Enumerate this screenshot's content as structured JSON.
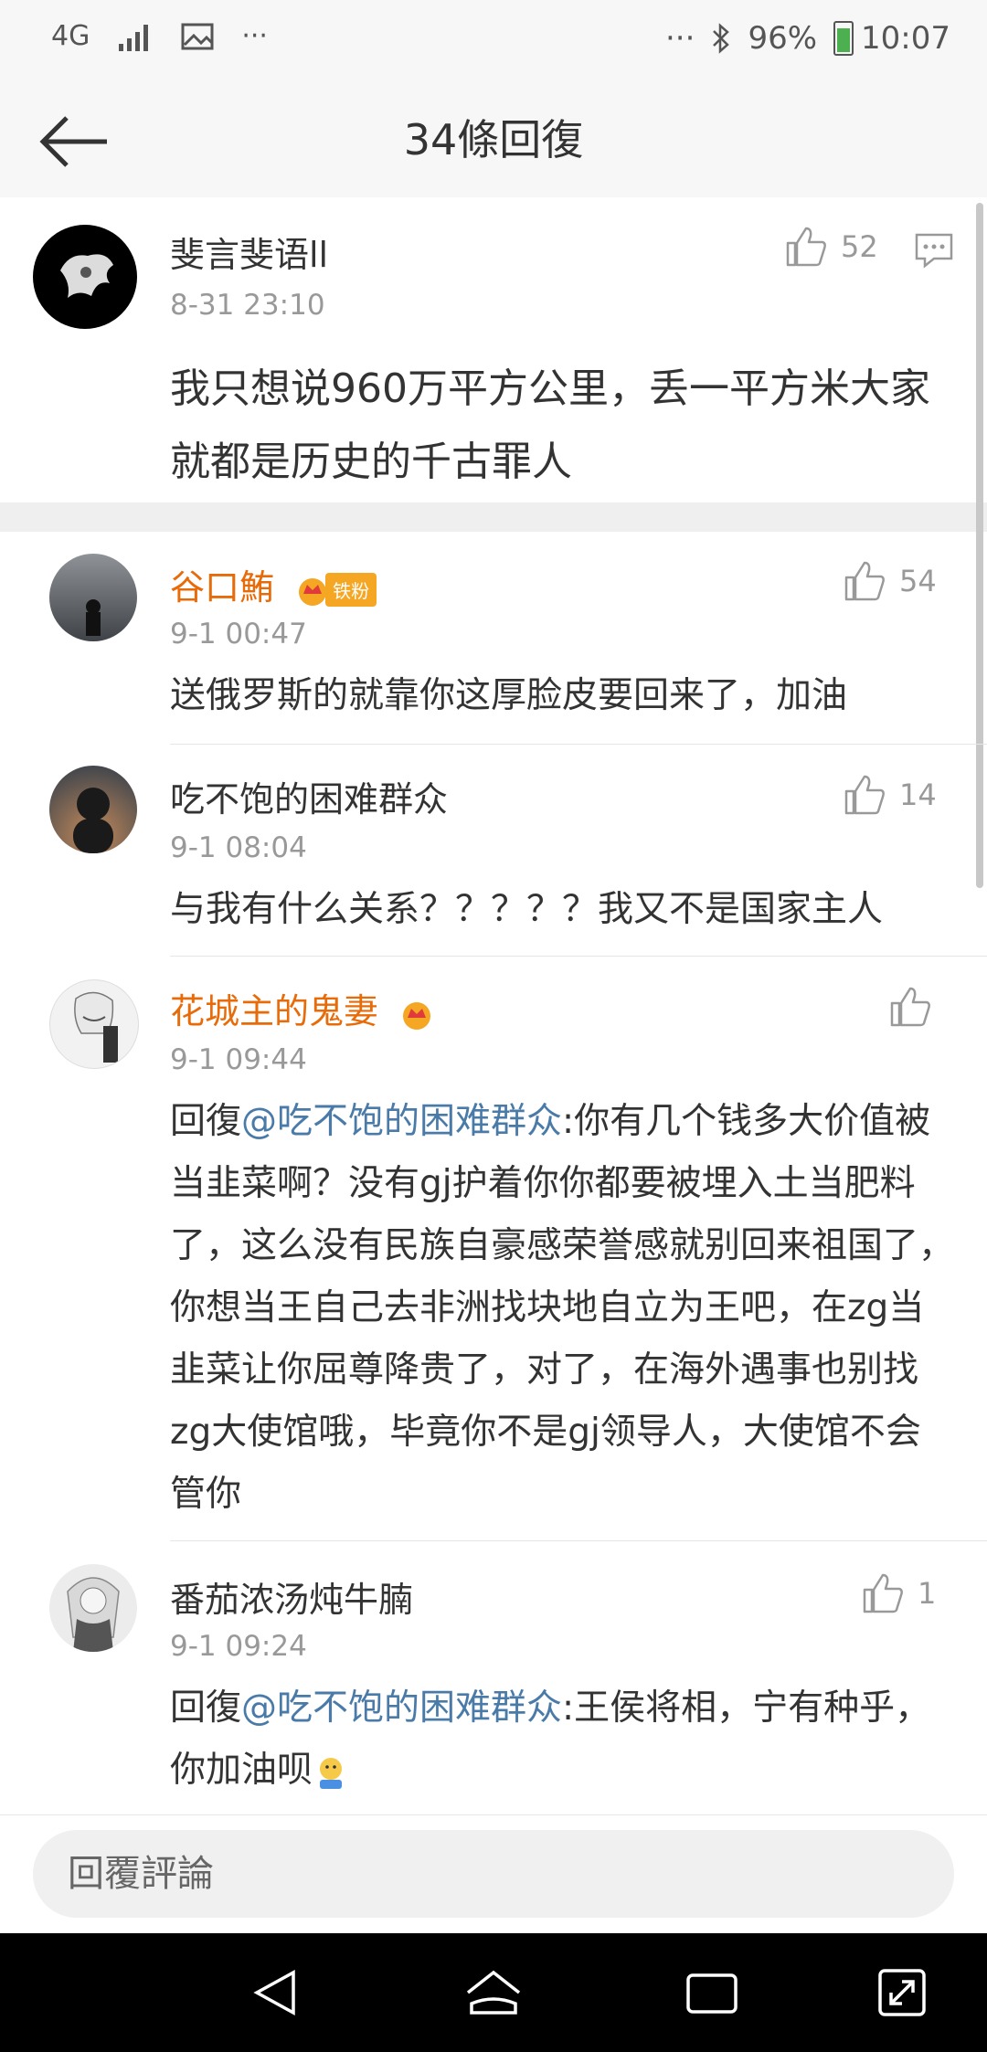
{
  "status_bar": {
    "network": "4G",
    "dots_left": "···",
    "dots_right": "···",
    "battery": "96%",
    "time": "10:07"
  },
  "header": {
    "title": "34條回復"
  },
  "main_comment": {
    "username": "斐言斐语ll",
    "time": "8-31 23:10",
    "likes": "52",
    "content": "我只想说960万平方公里，丢一平方米大家就都是历史的千古罪人"
  },
  "replies": [
    {
      "username": "谷口鮪",
      "badge": "铁粉",
      "time": "9-1 00:47",
      "likes": "54",
      "content": "送俄罗斯的就靠你这厚脸皮要回来了，加油"
    },
    {
      "username": "吃不饱的困难群众",
      "time": "9-1 08:04",
      "likes": "14",
      "content": "与我有什么关系？？？？？我又不是国家主人"
    },
    {
      "username": "花城主的鬼妻",
      "time": "9-1 09:44",
      "likes": "",
      "prefix": "回復",
      "mention": "@吃不饱的困难群众",
      "content": ":你有几个钱多大价值被当韭菜啊？没有gj护着你你都要被埋入土当肥料了，这么没有民族自豪感荣誉感就别回来祖国了，你想当王自己去非洲找块地自立为王吧，在zg当韭菜让你屈尊降贵了，对了，在海外遇事也别找zg大使馆哦，毕竟你不是gj领导人，大使馆不会管你"
    },
    {
      "username": "番茄浓汤炖牛腩",
      "time": "9-1 09:24",
      "likes": "1",
      "prefix": "回復",
      "mention": "@吃不饱的困难群众",
      "content": ":王侯将相，宁有种乎，你加油呗"
    }
  ],
  "input": {
    "placeholder": "回覆評論"
  },
  "colors": {
    "accent_orange": "#e86b0a",
    "mention_blue": "#4a7ba8",
    "badge_gold": "#f5a623"
  }
}
